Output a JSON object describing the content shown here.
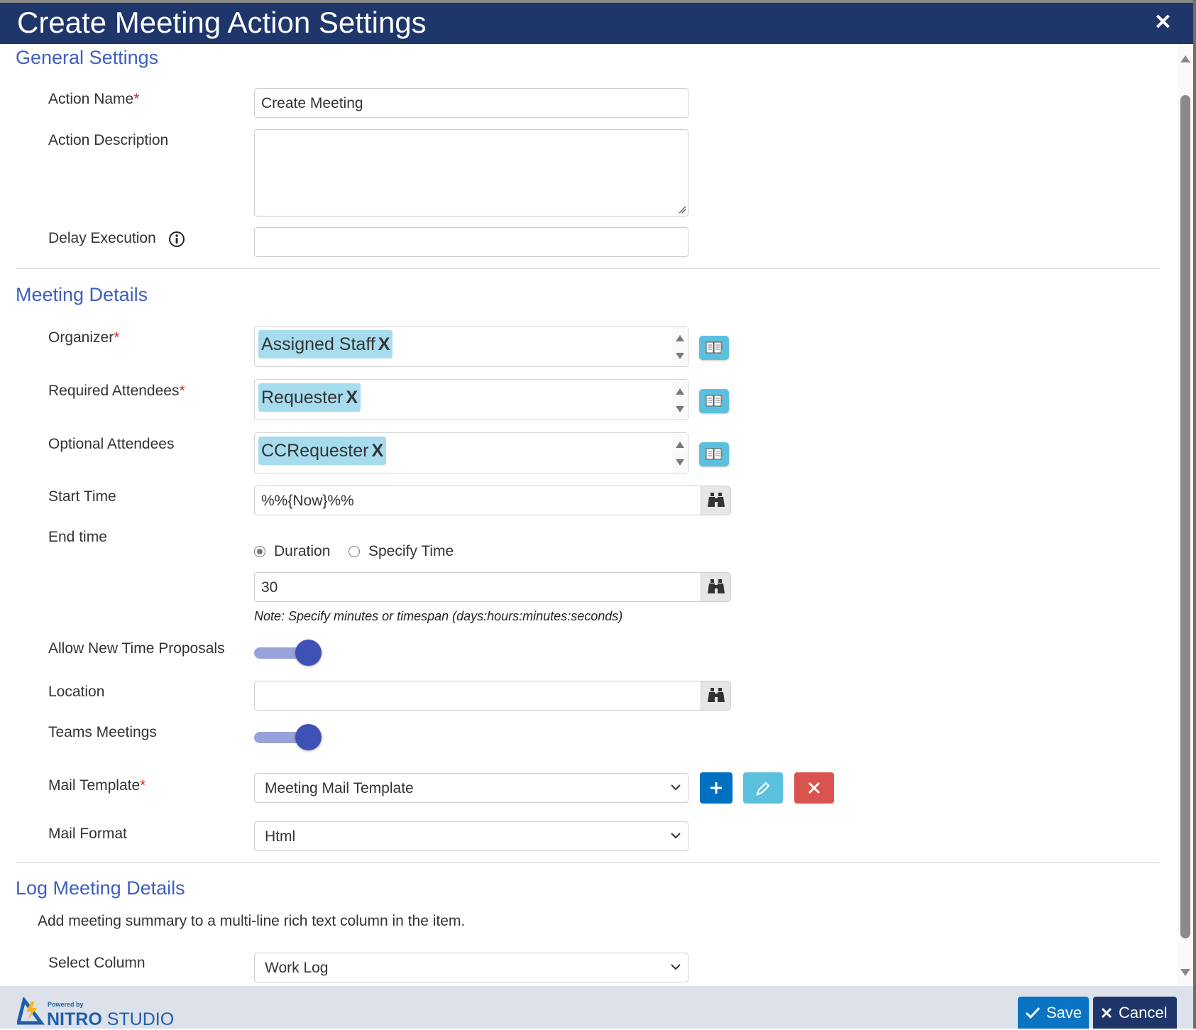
{
  "dialog": {
    "title": "Create Meeting Action Settings",
    "close_icon": "close-icon"
  },
  "general": {
    "heading": "General Settings",
    "action_name_label": "Action Name",
    "action_name_value": "Create Meeting",
    "action_description_label": "Action Description",
    "action_description_value": "",
    "delay_execution_label": "Delay Execution",
    "delay_execution_value": "",
    "required_marker": "*"
  },
  "meeting": {
    "heading": "Meeting Details",
    "organizer_label": "Organizer",
    "organizer_tag": "Assigned Staff",
    "required_attendees_label": "Required Attendees",
    "required_attendees_tag": "Requester",
    "optional_attendees_label": "Optional Attendees",
    "optional_attendees_tag": "CCRequester",
    "tag_remove": "X",
    "start_time_label": "Start Time",
    "start_time_value": "%%{Now}%%",
    "end_time_label": "End time",
    "end_time_options": [
      {
        "label": "Duration",
        "selected": true
      },
      {
        "label": "Specify Time",
        "selected": false
      }
    ],
    "duration_value": "30",
    "duration_note": "Note: Specify minutes or timespan (days:hours:minutes:seconds)",
    "allow_proposals_label": "Allow New Time Proposals",
    "allow_proposals_on": true,
    "location_label": "Location",
    "location_value": "",
    "teams_label": "Teams Meetings",
    "teams_on": true,
    "mail_template_label": "Mail Template",
    "mail_template_value": "Meeting Mail Template",
    "mail_format_label": "Mail Format",
    "mail_format_value": "Html"
  },
  "log": {
    "heading": "Log Meeting Details",
    "description": "Add meeting summary to a multi-line rich text column in the item.",
    "select_column_label": "Select Column",
    "select_column_value": "Work Log"
  },
  "footer": {
    "powered_by": "Powered by",
    "brand_bold": "NITRO",
    "brand_light": "STUDIO",
    "save_label": "Save",
    "cancel_label": "Cancel"
  },
  "colors": {
    "titlebar": "#1f366b",
    "section_heading": "#3f5fbf",
    "tag_bg": "#a6dcee",
    "info_btn": "#5bc0de",
    "add_btn": "#0070c0",
    "delete_btn": "#d9534f",
    "toggle_on": "#3f51b5",
    "cancel_btn": "#1f366b"
  }
}
